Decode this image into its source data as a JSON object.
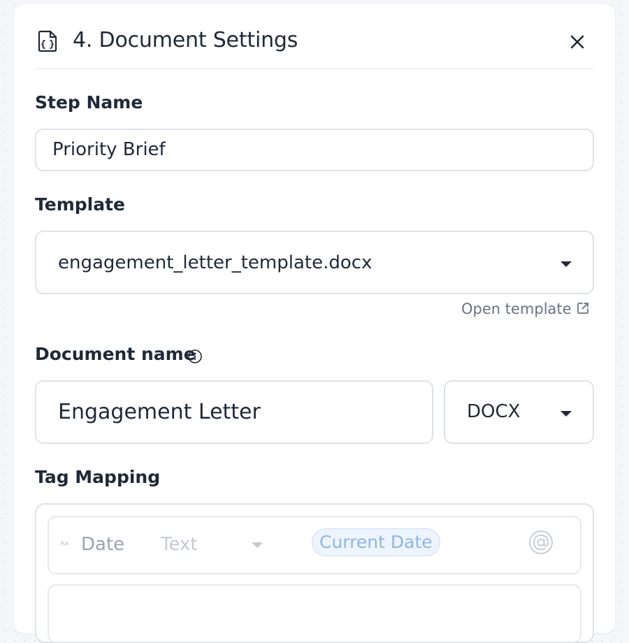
{
  "header": {
    "title": "4. Document Settings",
    "icon": "file-code-icon",
    "close_icon": "close-icon"
  },
  "step_name": {
    "label": "Step Name",
    "value": "Priority Brief"
  },
  "template": {
    "label": "Template",
    "selected": "engagement_letter_template.docx",
    "open_link": "Open template",
    "open_link_icon": "external-link-icon"
  },
  "document_name": {
    "label": "Document name",
    "info_icon": "info-icon",
    "value": "Engagement Letter",
    "format": "DOCX"
  },
  "tag_mapping": {
    "label": "Tag Mapping",
    "rows": [
      {
        "type_glyph": "Aa",
        "tag": "Date",
        "kind": "Text",
        "mapped_value": "Current Date",
        "mention_icon": "at-sign-icon"
      }
    ]
  },
  "colors": {
    "accent_chip_bg": "#edf4fd",
    "accent_chip_text": "#8fb6e4",
    "border": "#dfe2e7",
    "text": "#1f2937",
    "muted": "#6b7280"
  }
}
